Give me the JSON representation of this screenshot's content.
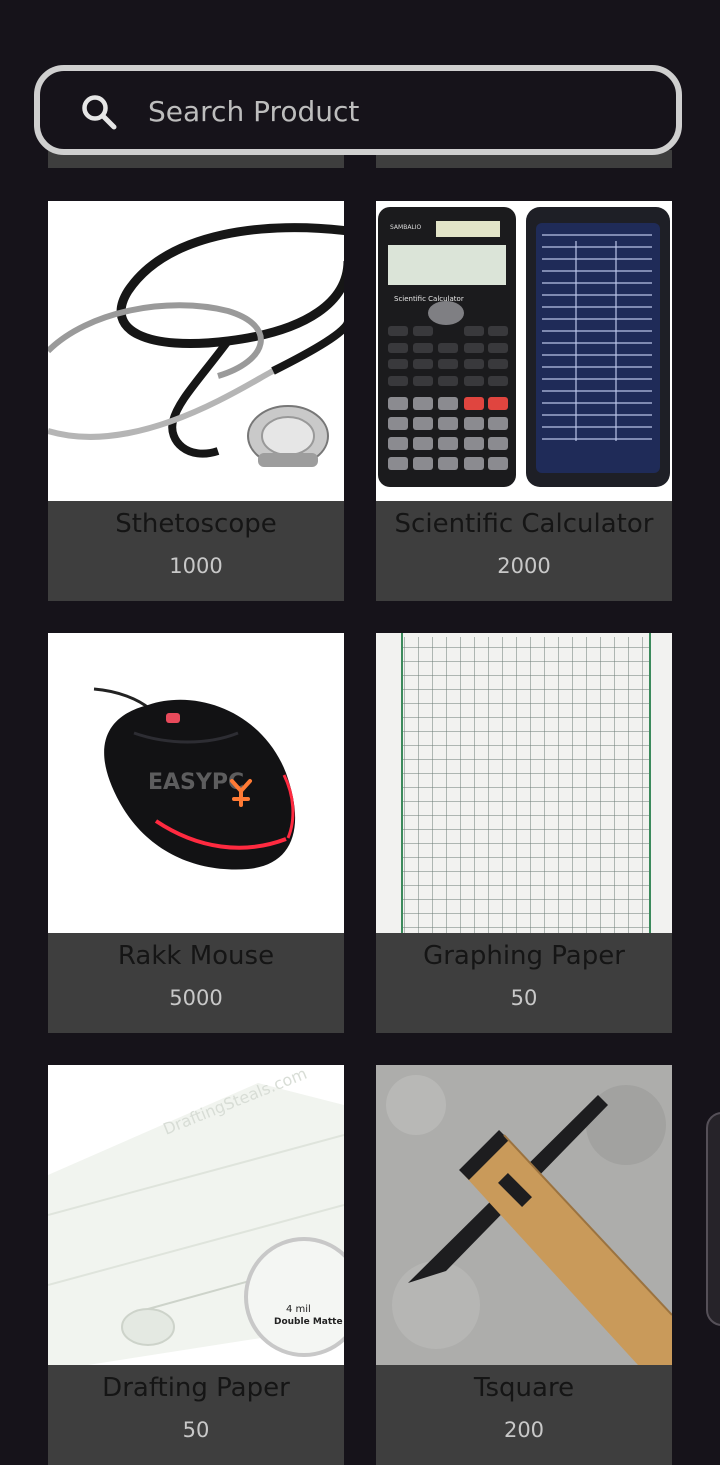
{
  "search": {
    "placeholder": "Search Product"
  },
  "products": [
    {
      "name": "Sthetoscope",
      "price": "1000",
      "image": "stethoscope"
    },
    {
      "name": "Scientific Calculator",
      "price": "2000",
      "image": "scientific-calculator"
    },
    {
      "name": "Rakk Mouse",
      "price": "5000",
      "image": "gaming-mouse"
    },
    {
      "name": "Graphing Paper",
      "price": "50",
      "image": "graph-paper"
    },
    {
      "name": "Drafting Paper",
      "price": "50",
      "image": "drafting-paper-roll"
    },
    {
      "name": "Tsquare",
      "price": "200",
      "image": "t-square-ruler"
    }
  ],
  "images": {
    "calculator_brand": "SAMBALIO",
    "calculator_label": "Scientific Calculator",
    "drafting_watermark": "DraftingSteals.com",
    "drafting_label_1": "4 mil",
    "drafting_label_2": "Double Matte",
    "mouse_watermark": "EASYPC"
  },
  "colors": {
    "background": "#16131a",
    "card": "#3e3e3e",
    "product_name": "#151515",
    "price": "#c8c8c8",
    "search_border": "#cfcfcf"
  }
}
